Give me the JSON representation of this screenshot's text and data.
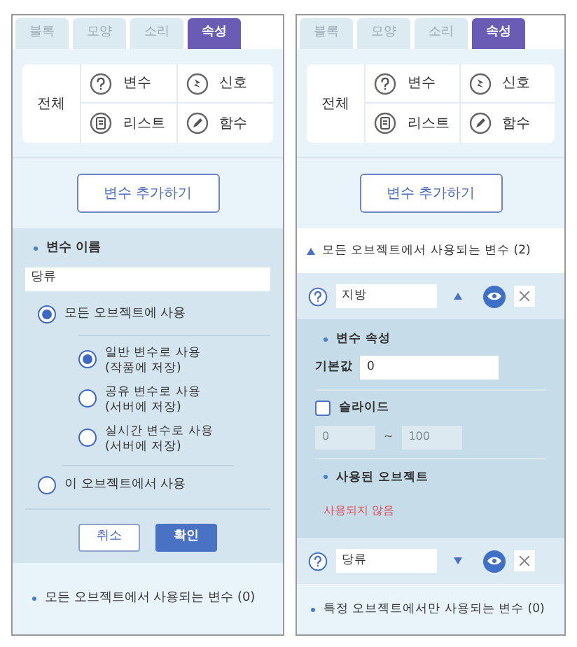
{
  "left_panel": {
    "tabs": [
      {
        "label": "블록",
        "selected": false
      },
      {
        "label": "모양",
        "selected": false
      },
      {
        "label": "소리",
        "selected": false
      },
      {
        "label": "속성",
        "selected": true
      }
    ],
    "categories": {
      "all": "전체",
      "items": [
        {
          "kind": "variable",
          "label": "변수"
        },
        {
          "kind": "signal",
          "label": "신호"
        },
        {
          "kind": "list",
          "label": "리스트"
        },
        {
          "kind": "function",
          "label": "함수"
        }
      ]
    },
    "add_button": "변수 추가하기",
    "form": {
      "name_label": "변수 이름",
      "name_value": "당류",
      "scopes": [
        {
          "label": "모든 오브젝트에 사용",
          "selected": true,
          "children": [
            {
              "label": "일반 변수로 사용",
              "note": "(작품에 저장)",
              "selected": true
            },
            {
              "label": "공유 변수로 사용",
              "note": "(서버에 저장)",
              "selected": false
            },
            {
              "label": "실시간 변수로 사용",
              "note": "(서버에 저장)",
              "selected": false
            }
          ]
        },
        {
          "label": "이 오브젝트에서 사용",
          "selected": false
        }
      ],
      "cancel": "취소",
      "confirm": "확인"
    },
    "footer": "모든 오브젝트에서 사용되는 변수 (0)"
  },
  "right_panel": {
    "tabs": [
      {
        "label": "블록",
        "selected": false
      },
      {
        "label": "모양",
        "selected": false
      },
      {
        "label": "소리",
        "selected": false
      },
      {
        "label": "속성",
        "selected": true
      }
    ],
    "categories": {
      "all": "전체",
      "items": [
        {
          "kind": "variable",
          "label": "변수"
        },
        {
          "kind": "signal",
          "label": "신호"
        },
        {
          "kind": "list",
          "label": "리스트"
        },
        {
          "kind": "function",
          "label": "함수"
        }
      ]
    },
    "add_button": "변수 추가하기",
    "section": {
      "title": "모든 오브젝트에서 사용되는 변수 (2)",
      "expanded": true
    },
    "variables": [
      {
        "name": "지방",
        "expanded": true,
        "details": {
          "title": "변수 속성",
          "default_label": "기본값",
          "default_value": "0",
          "slider_label": "슬라이드",
          "slider_checked": false,
          "min": "0",
          "separator": "~",
          "max": "100",
          "used_title": "사용된 오브젝트",
          "used_value": "사용되지 않음"
        }
      },
      {
        "name": "당류",
        "expanded": false
      }
    ],
    "footer": "특정 오브젝트에서만 사용되는 변수 (0)"
  }
}
